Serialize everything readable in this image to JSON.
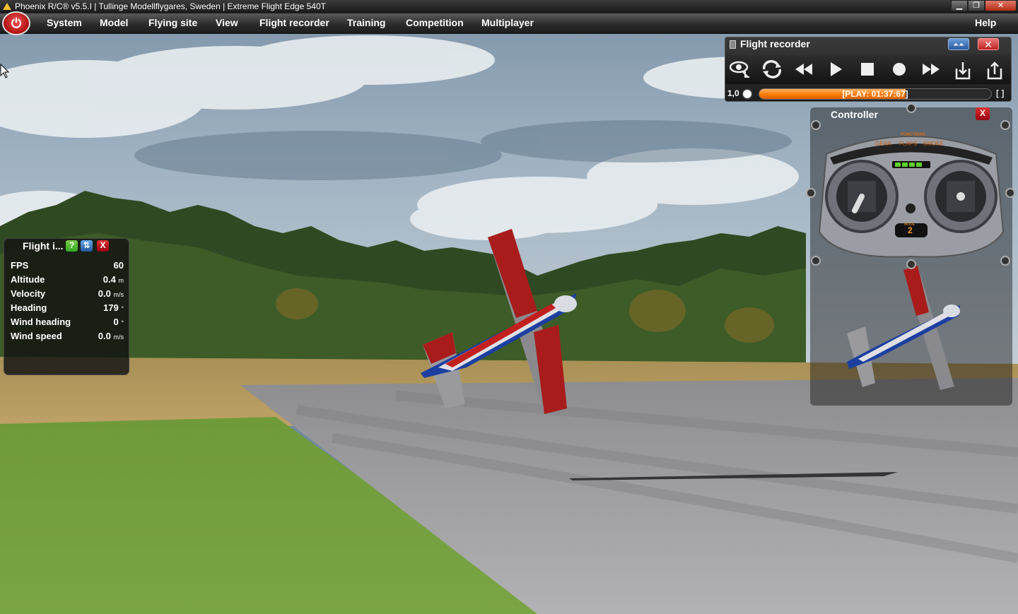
{
  "window": {
    "title": "Phoenix R/C® v5.5.I  |  Tullinge Modellflygares, Sweden  |  Extreme Flight Edge 540T",
    "minimize_label": "▁",
    "maximize_label": "❐",
    "close_label": "✕"
  },
  "menu": {
    "items": [
      "System",
      "Model",
      "Flying site",
      "View",
      "Flight recorder",
      "Training",
      "Competition",
      "Multiplayer"
    ],
    "help": "Help"
  },
  "flight_recorder": {
    "title": "Flight recorder",
    "collapse_label": "⏶⏶",
    "close_label": "✕",
    "speed": "1,0",
    "status": "[PLAY: 01:37:67]",
    "progress_fraction": 0.63,
    "expand_label": "[ ]",
    "buttons": [
      "camera-options",
      "loop",
      "rewind",
      "play",
      "stop",
      "record",
      "fast-forward",
      "load",
      "save"
    ]
  },
  "controller": {
    "title": "Controller",
    "close_label": "X",
    "functions_label": "FUNCTIONS",
    "switches": [
      "GEAR",
      "FLAPS",
      "SMOKE"
    ],
    "mode_label": "MODE",
    "mode_value": "2"
  },
  "flight_info": {
    "title": "Flight i...",
    "help_label": "?",
    "pin_label": "⇅",
    "close_label": "X",
    "rows": [
      {
        "label": "FPS",
        "value": "60",
        "unit": ""
      },
      {
        "label": "Altitude",
        "value": "0.4",
        "unit": "m"
      },
      {
        "label": "Velocity",
        "value": "0.0",
        "unit": "m/s"
      },
      {
        "label": "Heading",
        "value": "179",
        "unit": "°"
      },
      {
        "label": "Wind heading",
        "value": "0",
        "unit": "°"
      },
      {
        "label": "Wind speed",
        "value": "0.0",
        "unit": "m/s"
      }
    ]
  },
  "colors": {
    "accent_orange": "#ff7800",
    "close_red": "#c0281a",
    "plane_red": "#a81c1c",
    "plane_blue": "#1d3fa0"
  }
}
